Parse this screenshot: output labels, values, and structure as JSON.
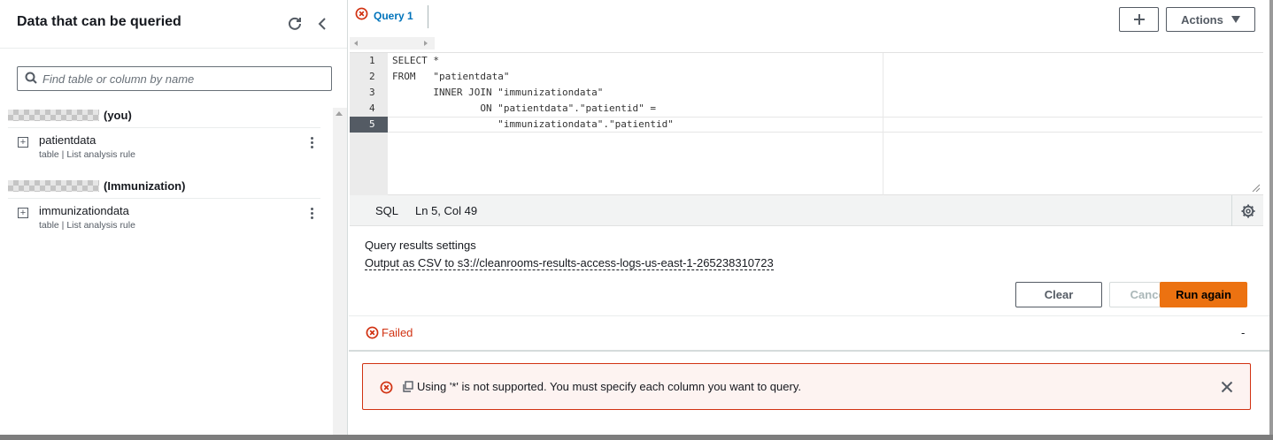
{
  "left_panel": {
    "title": "Data that can be queried",
    "search_placeholder": "Find table or column by name",
    "groups": [
      {
        "owner": "(you)",
        "tables": [
          {
            "name": "patientdata",
            "subtitle": "table | List analysis rule"
          }
        ]
      },
      {
        "owner": "(Immunization)",
        "tables": [
          {
            "name": "immunizationdata",
            "subtitle": "table | List analysis rule"
          }
        ]
      }
    ]
  },
  "editor": {
    "tab_label": "Query 1",
    "actions_label": "Actions",
    "line_numbers": [
      "1",
      "2",
      "3",
      "4",
      "5"
    ],
    "lines": [
      "SELECT *",
      "FROM   \"patientdata\"",
      "       INNER JOIN \"immunizationdata\"",
      "               ON \"patientdata\".\"patientid\" =",
      "                  \"immunizationdata\".\"patientid\""
    ],
    "language": "SQL",
    "cursor_position": "Ln 5, Col 49"
  },
  "results_settings": {
    "title": "Query results settings",
    "output": "Output as CSV to s3://cleanrooms-results-access-logs-us-east-1-265238310723"
  },
  "buttons": {
    "clear": "Clear",
    "cancel": "Cancel",
    "run_again": "Run again"
  },
  "status": {
    "label": "Failed",
    "value": "-"
  },
  "error": {
    "message": "Using '*' is not supported. You must specify each column you want to query."
  },
  "colors": {
    "accent": "#0073bb",
    "primary_button": "#ec7211",
    "error": "#d13212"
  }
}
